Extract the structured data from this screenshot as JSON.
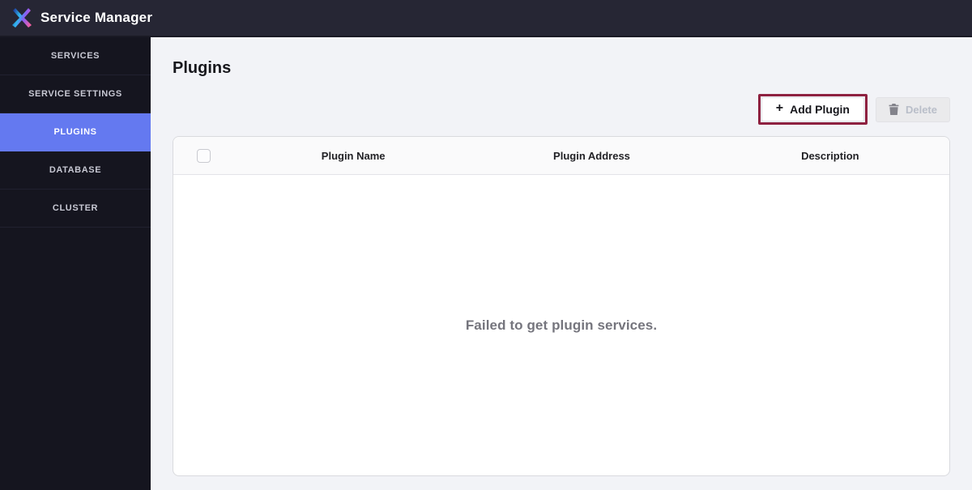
{
  "topbar": {
    "title": "Service Manager",
    "logo_icon": "x-gradient-logo"
  },
  "sidebar": {
    "active_color": "#6479f0",
    "items": [
      {
        "label": "SERVICES",
        "active": false
      },
      {
        "label": "SERVICE SETTINGS",
        "active": false
      },
      {
        "label": "PLUGINS",
        "active": true
      },
      {
        "label": "DATABASE",
        "active": false
      },
      {
        "label": "CLUSTER",
        "active": false
      }
    ]
  },
  "main": {
    "page_title": "Plugins",
    "toolbar": {
      "add_button_label": "Add Plugin",
      "add_button_icon": "plus-icon",
      "add_icon_glyph": "+",
      "delete_button_label": "Delete",
      "delete_button_icon": "trash-icon",
      "delete_disabled": true,
      "annotation_color": "#8e2140"
    },
    "table": {
      "headers": [
        "Plugin Name",
        "Plugin Address",
        "Description"
      ],
      "select_all_checked": false,
      "rows": [],
      "empty_message": "Failed to get plugin services."
    }
  }
}
